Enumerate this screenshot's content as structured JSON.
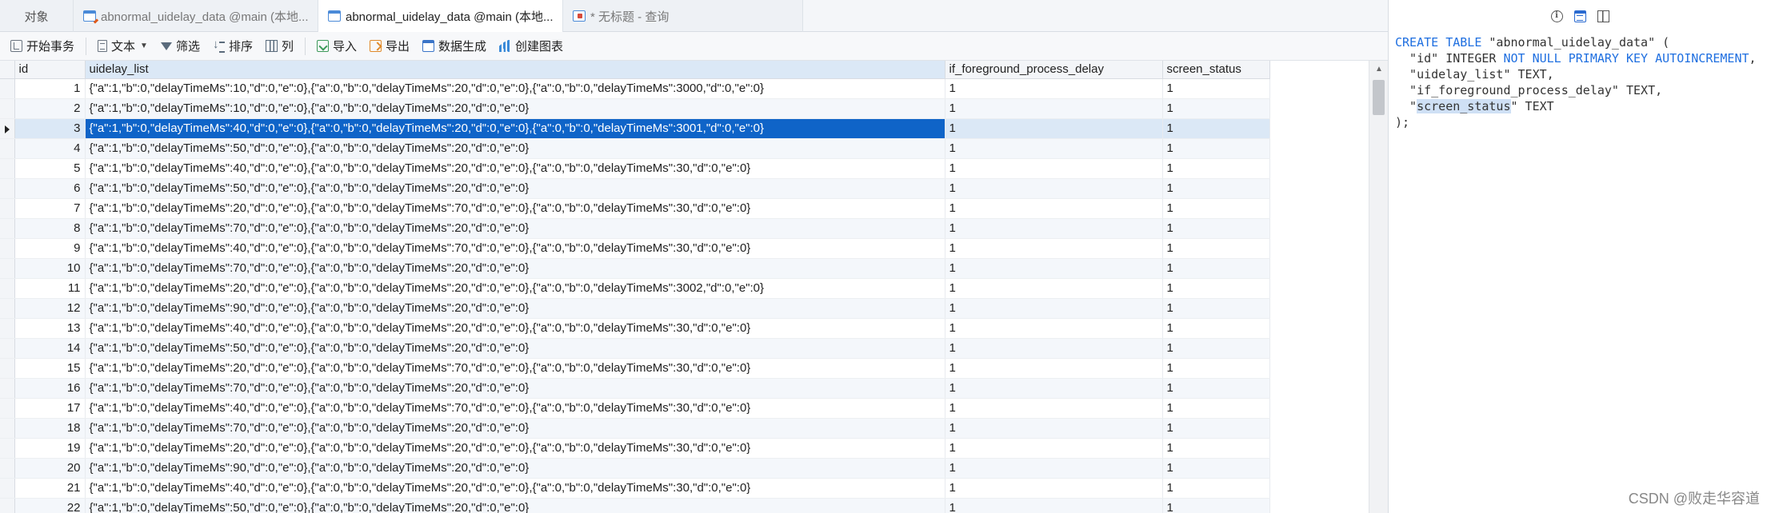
{
  "tabs": [
    {
      "label": "对象",
      "icon": "none"
    },
    {
      "label": "abnormal_uidelay_data @main (本地...",
      "icon": "table-edit-icon"
    },
    {
      "label": "abnormal_uidelay_data @main (本地...",
      "icon": "table-icon"
    },
    {
      "label": "* 无标题 - 查询",
      "icon": "query-icon"
    }
  ],
  "toolbar": {
    "begin_transaction": "开始事务",
    "text": "文本",
    "filter": "筛选",
    "sort": "排序",
    "columns": "列",
    "import": "导入",
    "export": "导出",
    "data_generation": "数据生成",
    "create_chart": "创建图表"
  },
  "table": {
    "columns": [
      "id",
      "uidelay_list",
      "if_foreground_process_delay",
      "screen_status"
    ],
    "selected_row": 3,
    "rows": [
      {
        "id": "1",
        "uidelay_list": "{\"a\":1,\"b\":0,\"delayTimeMs\":10,\"d\":0,\"e\":0},{\"a\":0,\"b\":0,\"delayTimeMs\":20,\"d\":0,\"e\":0},{\"a\":0,\"b\":0,\"delayTimeMs\":3000,\"d\":0,\"e\":0}",
        "if_foreground_process_delay": "1",
        "screen_status": "1"
      },
      {
        "id": "2",
        "uidelay_list": "{\"a\":1,\"b\":0,\"delayTimeMs\":10,\"d\":0,\"e\":0},{\"a\":0,\"b\":0,\"delayTimeMs\":20,\"d\":0,\"e\":0}",
        "if_foreground_process_delay": "1",
        "screen_status": "1"
      },
      {
        "id": "3",
        "uidelay_list": "{\"a\":1,\"b\":0,\"delayTimeMs\":40,\"d\":0,\"e\":0},{\"a\":0,\"b\":0,\"delayTimeMs\":20,\"d\":0,\"e\":0},{\"a\":0,\"b\":0,\"delayTimeMs\":3001,\"d\":0,\"e\":0}",
        "if_foreground_process_delay": "1",
        "screen_status": "1"
      },
      {
        "id": "4",
        "uidelay_list": "{\"a\":1,\"b\":0,\"delayTimeMs\":50,\"d\":0,\"e\":0},{\"a\":0,\"b\":0,\"delayTimeMs\":20,\"d\":0,\"e\":0}",
        "if_foreground_process_delay": "1",
        "screen_status": "1"
      },
      {
        "id": "5",
        "uidelay_list": "{\"a\":1,\"b\":0,\"delayTimeMs\":40,\"d\":0,\"e\":0},{\"a\":0,\"b\":0,\"delayTimeMs\":20,\"d\":0,\"e\":0},{\"a\":0,\"b\":0,\"delayTimeMs\":30,\"d\":0,\"e\":0}",
        "if_foreground_process_delay": "1",
        "screen_status": "1"
      },
      {
        "id": "6",
        "uidelay_list": "{\"a\":1,\"b\":0,\"delayTimeMs\":50,\"d\":0,\"e\":0},{\"a\":0,\"b\":0,\"delayTimeMs\":20,\"d\":0,\"e\":0}",
        "if_foreground_process_delay": "1",
        "screen_status": "1"
      },
      {
        "id": "7",
        "uidelay_list": "{\"a\":1,\"b\":0,\"delayTimeMs\":20,\"d\":0,\"e\":0},{\"a\":0,\"b\":0,\"delayTimeMs\":70,\"d\":0,\"e\":0},{\"a\":0,\"b\":0,\"delayTimeMs\":30,\"d\":0,\"e\":0}",
        "if_foreground_process_delay": "1",
        "screen_status": "1"
      },
      {
        "id": "8",
        "uidelay_list": "{\"a\":1,\"b\":0,\"delayTimeMs\":70,\"d\":0,\"e\":0},{\"a\":0,\"b\":0,\"delayTimeMs\":20,\"d\":0,\"e\":0}",
        "if_foreground_process_delay": "1",
        "screen_status": "1"
      },
      {
        "id": "9",
        "uidelay_list": "{\"a\":1,\"b\":0,\"delayTimeMs\":40,\"d\":0,\"e\":0},{\"a\":0,\"b\":0,\"delayTimeMs\":70,\"d\":0,\"e\":0},{\"a\":0,\"b\":0,\"delayTimeMs\":30,\"d\":0,\"e\":0}",
        "if_foreground_process_delay": "1",
        "screen_status": "1"
      },
      {
        "id": "10",
        "uidelay_list": "{\"a\":1,\"b\":0,\"delayTimeMs\":70,\"d\":0,\"e\":0},{\"a\":0,\"b\":0,\"delayTimeMs\":20,\"d\":0,\"e\":0}",
        "if_foreground_process_delay": "1",
        "screen_status": "1"
      },
      {
        "id": "11",
        "uidelay_list": "{\"a\":1,\"b\":0,\"delayTimeMs\":20,\"d\":0,\"e\":0},{\"a\":0,\"b\":0,\"delayTimeMs\":20,\"d\":0,\"e\":0},{\"a\":0,\"b\":0,\"delayTimeMs\":3002,\"d\":0,\"e\":0}",
        "if_foreground_process_delay": "1",
        "screen_status": "1"
      },
      {
        "id": "12",
        "uidelay_list": "{\"a\":1,\"b\":0,\"delayTimeMs\":90,\"d\":0,\"e\":0},{\"a\":0,\"b\":0,\"delayTimeMs\":20,\"d\":0,\"e\":0}",
        "if_foreground_process_delay": "1",
        "screen_status": "1"
      },
      {
        "id": "13",
        "uidelay_list": "{\"a\":1,\"b\":0,\"delayTimeMs\":40,\"d\":0,\"e\":0},{\"a\":0,\"b\":0,\"delayTimeMs\":20,\"d\":0,\"e\":0},{\"a\":0,\"b\":0,\"delayTimeMs\":30,\"d\":0,\"e\":0}",
        "if_foreground_process_delay": "1",
        "screen_status": "1"
      },
      {
        "id": "14",
        "uidelay_list": "{\"a\":1,\"b\":0,\"delayTimeMs\":50,\"d\":0,\"e\":0},{\"a\":0,\"b\":0,\"delayTimeMs\":20,\"d\":0,\"e\":0}",
        "if_foreground_process_delay": "1",
        "screen_status": "1"
      },
      {
        "id": "15",
        "uidelay_list": "{\"a\":1,\"b\":0,\"delayTimeMs\":20,\"d\":0,\"e\":0},{\"a\":0,\"b\":0,\"delayTimeMs\":70,\"d\":0,\"e\":0},{\"a\":0,\"b\":0,\"delayTimeMs\":30,\"d\":0,\"e\":0}",
        "if_foreground_process_delay": "1",
        "screen_status": "1"
      },
      {
        "id": "16",
        "uidelay_list": "{\"a\":1,\"b\":0,\"delayTimeMs\":70,\"d\":0,\"e\":0},{\"a\":0,\"b\":0,\"delayTimeMs\":20,\"d\":0,\"e\":0}",
        "if_foreground_process_delay": "1",
        "screen_status": "1"
      },
      {
        "id": "17",
        "uidelay_list": "{\"a\":1,\"b\":0,\"delayTimeMs\":40,\"d\":0,\"e\":0},{\"a\":0,\"b\":0,\"delayTimeMs\":70,\"d\":0,\"e\":0},{\"a\":0,\"b\":0,\"delayTimeMs\":30,\"d\":0,\"e\":0}",
        "if_foreground_process_delay": "1",
        "screen_status": "1"
      },
      {
        "id": "18",
        "uidelay_list": "{\"a\":1,\"b\":0,\"delayTimeMs\":70,\"d\":0,\"e\":0},{\"a\":0,\"b\":0,\"delayTimeMs\":20,\"d\":0,\"e\":0}",
        "if_foreground_process_delay": "1",
        "screen_status": "1"
      },
      {
        "id": "19",
        "uidelay_list": "{\"a\":1,\"b\":0,\"delayTimeMs\":20,\"d\":0,\"e\":0},{\"a\":0,\"b\":0,\"delayTimeMs\":20,\"d\":0,\"e\":0},{\"a\":0,\"b\":0,\"delayTimeMs\":30,\"d\":0,\"e\":0}",
        "if_foreground_process_delay": "1",
        "screen_status": "1"
      },
      {
        "id": "20",
        "uidelay_list": "{\"a\":1,\"b\":0,\"delayTimeMs\":90,\"d\":0,\"e\":0},{\"a\":0,\"b\":0,\"delayTimeMs\":20,\"d\":0,\"e\":0}",
        "if_foreground_process_delay": "1",
        "screen_status": "1"
      },
      {
        "id": "21",
        "uidelay_list": "{\"a\":1,\"b\":0,\"delayTimeMs\":40,\"d\":0,\"e\":0},{\"a\":0,\"b\":0,\"delayTimeMs\":20,\"d\":0,\"e\":0},{\"a\":0,\"b\":0,\"delayTimeMs\":30,\"d\":0,\"e\":0}",
        "if_foreground_process_delay": "1",
        "screen_status": "1"
      },
      {
        "id": "22",
        "uidelay_list": "{\"a\":1,\"b\":0,\"delayTimeMs\":50,\"d\":0,\"e\":0},{\"a\":0,\"b\":0,\"delayTimeMs\":20,\"d\":0,\"e\":0}",
        "if_foreground_process_delay": "1",
        "screen_status": "1"
      }
    ]
  },
  "ddl": {
    "icons": [
      "info-icon",
      "ddl-view-icon",
      "layout-icon"
    ],
    "lines": [
      {
        "kw1": "CREATE TABLE",
        "rest": " \"abnormal_uidelay_data\" ("
      },
      {
        "pre": "  \"id\" INTEGER ",
        "kw2": "NOT NULL PRIMARY KEY AUTOINCREMENT",
        "post": ","
      },
      {
        "text": "  \"uidelay_list\" TEXT,"
      },
      {
        "text": "  \"if_foreground_process_delay\" TEXT,"
      },
      {
        "pre": "  \"",
        "hl": "screen_status",
        "post": "\" TEXT"
      },
      {
        "text": ");"
      }
    ]
  },
  "watermark": "CSDN @败走华容道",
  "colors": {
    "selection": "#0f64c8",
    "keyword": "#1f6fe0",
    "tabbar": "#eef1f5"
  }
}
